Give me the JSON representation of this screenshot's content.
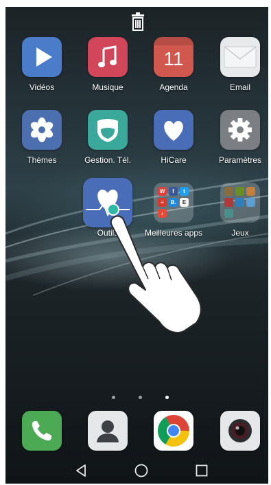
{
  "home_screen": {
    "apps_row1": [
      {
        "label": "Vidéos",
        "icon": "play-icon",
        "color": "#4a7cc9"
      },
      {
        "label": "Musique",
        "icon": "music-note-icon",
        "color": "#d2465a"
      },
      {
        "label": "Agenda",
        "icon": "calendar-icon",
        "color": "#d0584e",
        "day": "11"
      },
      {
        "label": "Email",
        "icon": "envelope-icon",
        "color": "#e8e9ea"
      }
    ],
    "apps_row2": [
      {
        "label": "Thèmes",
        "icon": "pinwheel-icon",
        "color": "#4c6fb0"
      },
      {
        "label": "Gestion. Tél.",
        "icon": "shield-icon",
        "color": "#3aa89a"
      },
      {
        "label": "HiCare",
        "icon": "heart-icon",
        "color": "#4a6db8"
      },
      {
        "label": "Paramètres",
        "icon": "gear-icon",
        "color": "#7b7e83"
      }
    ],
    "apps_row3": [
      {
        "label": "Outils",
        "icon": "heart-pulse-icon",
        "color": "#4a6db8"
      },
      {
        "label": "Meilleures apps",
        "icon": "folder-icon"
      },
      {
        "label": "Jeux",
        "icon": "folder-icon"
      }
    ],
    "page_indicator": {
      "pages": 3,
      "current": 3
    },
    "dock": [
      {
        "name": "phone",
        "icon": "phone-icon",
        "color": "#4caa54"
      },
      {
        "name": "contacts",
        "icon": "contact-icon",
        "color": "#e6e7e8"
      },
      {
        "name": "chrome",
        "icon": "chrome-icon",
        "color": "#ffffff"
      },
      {
        "name": "camera",
        "icon": "camera-icon",
        "color": "#e6e7e8"
      }
    ]
  },
  "nav_bar": {
    "back": "back-icon",
    "home": "home-icon",
    "recents": "recents-icon"
  },
  "top_bar": {
    "trash": "trash-icon"
  }
}
